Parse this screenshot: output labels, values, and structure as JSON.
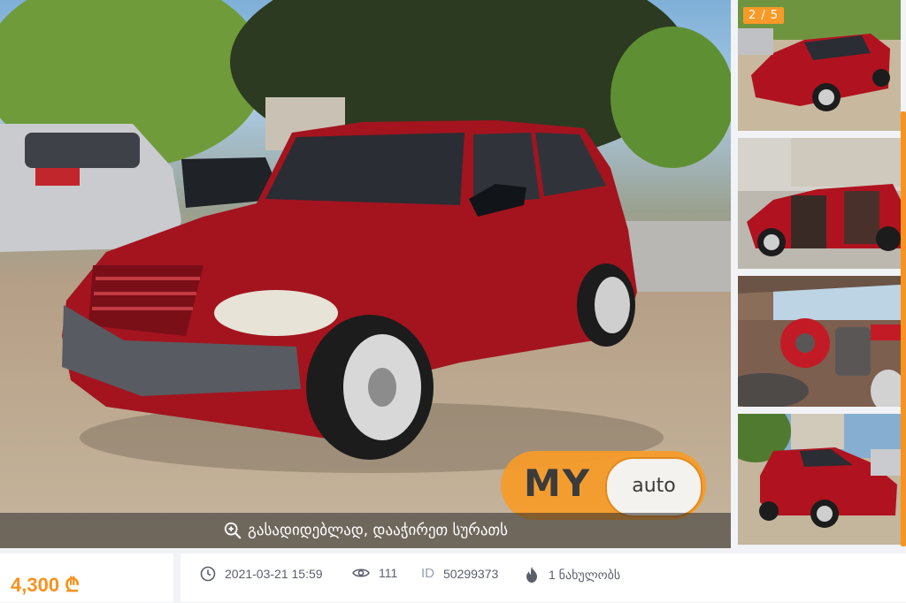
{
  "gallery": {
    "zoom_hint": "გასადიდებლად, დააჭირეთ სურათს",
    "watermark_my": "MY",
    "watermark_auto": "auto",
    "photo_counter": "2 / 5",
    "zoom_icon": "magnifier-plus-icon",
    "accent": "#f7931e"
  },
  "listing": {
    "price": "4,300 ₾",
    "date": "2021-03-21 15:59",
    "views": "111",
    "id_label": "ID",
    "id_value": "50299373",
    "popularity": "1 ნახულობს",
    "icons": [
      "clock-icon",
      "eye-icon",
      "fire-icon"
    ]
  },
  "colors": {
    "price": "#f7921e",
    "car": "#a3141f",
    "meta_text": "#5a5f6b"
  }
}
